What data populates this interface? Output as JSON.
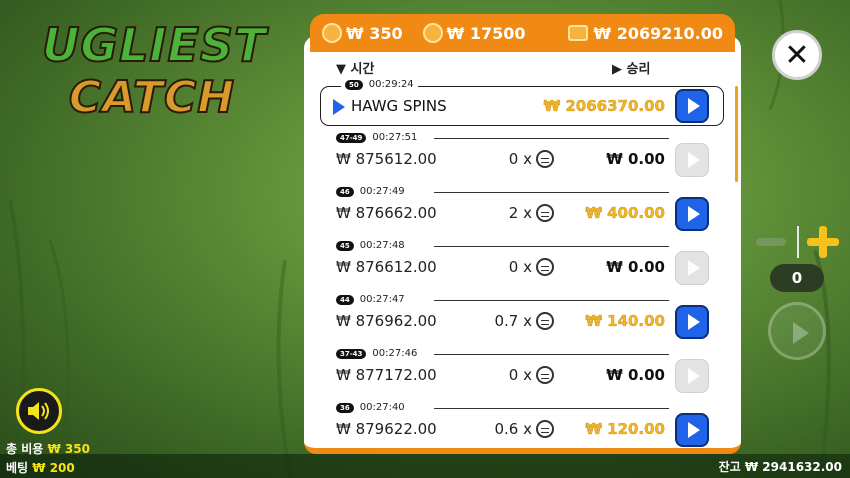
{
  "logo": {
    "line1": "UGLIEST",
    "line2": "CATCH"
  },
  "topbar": {
    "coin_bet_1": "₩ 350",
    "coin_bet_2": "₩ 17500",
    "wallet_total": "₩ 2069210.00"
  },
  "history": {
    "header_time": "시간",
    "header_win": "승리",
    "highlight": {
      "badge": "50",
      "time": "00:29:24",
      "label": "HAWG SPINS",
      "win": "₩ 2066370.00"
    },
    "rows": [
      {
        "badge": "47-49",
        "time": "00:27:51",
        "amount": "₩ 875612.00",
        "mult": "0 x",
        "win": "₩ 0.00",
        "active": false
      },
      {
        "badge": "46",
        "time": "00:27:49",
        "amount": "₩ 876662.00",
        "mult": "2 x",
        "win": "₩ 400.00",
        "active": true
      },
      {
        "badge": "45",
        "time": "00:27:48",
        "amount": "₩ 876612.00",
        "mult": "0 x",
        "win": "₩ 0.00",
        "active": false
      },
      {
        "badge": "44",
        "time": "00:27:47",
        "amount": "₩ 876962.00",
        "mult": "0.7 x",
        "win": "₩ 140.00",
        "active": true
      },
      {
        "badge": "37-43",
        "time": "00:27:46",
        "amount": "₩ 877172.00",
        "mult": "0 x",
        "win": "₩ 0.00",
        "active": false
      },
      {
        "badge": "36",
        "time": "00:27:40",
        "amount": "₩ 879622.00",
        "mult": "0.6 x",
        "win": "₩ 120.00",
        "active": true
      }
    ]
  },
  "controls": {
    "count": "0"
  },
  "footer": {
    "total_cost_label": "총 비용",
    "total_cost_value": "₩ 350",
    "bet_label": "베팅",
    "bet_value": "₩ 200",
    "balance_label": "잔고",
    "balance_value": "₩ 2941632.00"
  },
  "colors": {
    "accent": "#f08a14",
    "play_blue": "#1e63e8",
    "win_gold": "#f3b61f"
  }
}
